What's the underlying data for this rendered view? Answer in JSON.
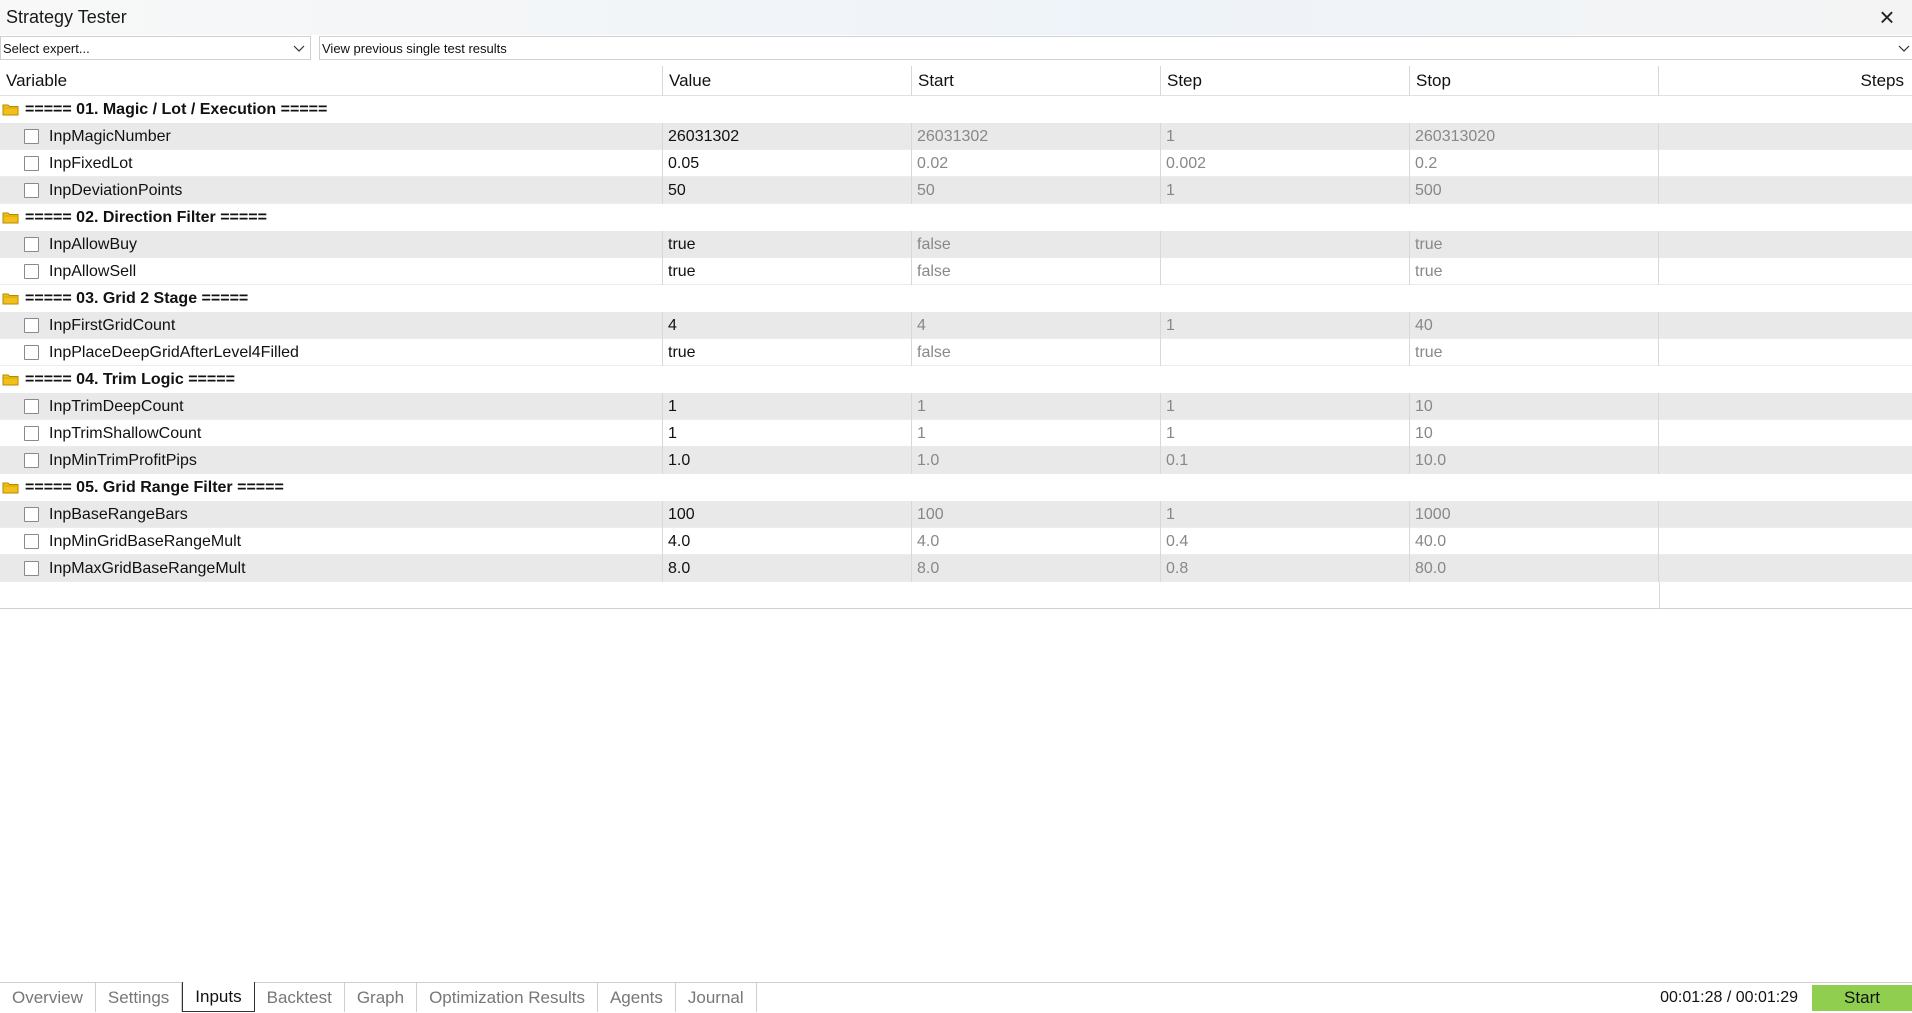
{
  "window": {
    "title": "Strategy Tester"
  },
  "selectors": {
    "expert": "Select expert...",
    "results": "View previous single test results"
  },
  "columns": [
    "Variable",
    "Value",
    "Start",
    "Step",
    "Stop",
    "Steps"
  ],
  "groups": [
    {
      "label": "===== 01. Magic / Lot / Execution =====",
      "rows": [
        {
          "name": "InpMagicNumber",
          "value": "26031302",
          "start": "26031302",
          "step": "1",
          "stop": "260313020",
          "steps": ""
        },
        {
          "name": "InpFixedLot",
          "value": "0.05",
          "start": "0.02",
          "step": "0.002",
          "stop": "0.2",
          "steps": ""
        },
        {
          "name": "InpDeviationPoints",
          "value": "50",
          "start": "50",
          "step": "1",
          "stop": "500",
          "steps": ""
        }
      ]
    },
    {
      "label": "===== 02. Direction Filter =====",
      "rows": [
        {
          "name": "InpAllowBuy",
          "value": "true",
          "start": "false",
          "step": "",
          "stop": "true",
          "steps": ""
        },
        {
          "name": "InpAllowSell",
          "value": "true",
          "start": "false",
          "step": "",
          "stop": "true",
          "steps": ""
        }
      ]
    },
    {
      "label": "===== 03. Grid 2 Stage =====",
      "rows": [
        {
          "name": "InpFirstGridCount",
          "value": "4",
          "start": "4",
          "step": "1",
          "stop": "40",
          "steps": ""
        },
        {
          "name": "InpPlaceDeepGridAfterLevel4Filled",
          "value": "true",
          "start": "false",
          "step": "",
          "stop": "true",
          "steps": ""
        }
      ]
    },
    {
      "label": "===== 04. Trim Logic =====",
      "rows": [
        {
          "name": "InpTrimDeepCount",
          "value": "1",
          "start": "1",
          "step": "1",
          "stop": "10",
          "steps": ""
        },
        {
          "name": "InpTrimShallowCount",
          "value": "1",
          "start": "1",
          "step": "1",
          "stop": "10",
          "steps": ""
        },
        {
          "name": "InpMinTrimProfitPips",
          "value": "1.0",
          "start": "1.0",
          "step": "0.1",
          "stop": "10.0",
          "steps": ""
        }
      ]
    },
    {
      "label": "===== 05. Grid Range Filter =====",
      "rows": [
        {
          "name": "InpBaseRangeBars",
          "value": "100",
          "start": "100",
          "step": "1",
          "stop": "1000",
          "steps": ""
        },
        {
          "name": "InpMinGridBaseRangeMult",
          "value": "4.0",
          "start": "4.0",
          "step": "0.4",
          "stop": "40.0",
          "steps": ""
        },
        {
          "name": "InpMaxGridBaseRangeMult",
          "value": "8.0",
          "start": "8.0",
          "step": "0.8",
          "stop": "80.0",
          "steps": ""
        }
      ]
    }
  ],
  "tabs": [
    "Overview",
    "Settings",
    "Inputs",
    "Backtest",
    "Graph",
    "Optimization Results",
    "Agents",
    "Journal"
  ],
  "active_tab": "Inputs",
  "timer": "00:01:28 / 00:01:29",
  "start_label": "Start",
  "colors": {
    "start_button": "#8fce4f",
    "folder": "#f2c01a",
    "row_shade": "#e9e9e9"
  },
  "icons": {
    "close": "close-icon",
    "dropdown": "chevron-down-icon",
    "group": "folder-icon",
    "checkbox": "checkbox-icon"
  }
}
